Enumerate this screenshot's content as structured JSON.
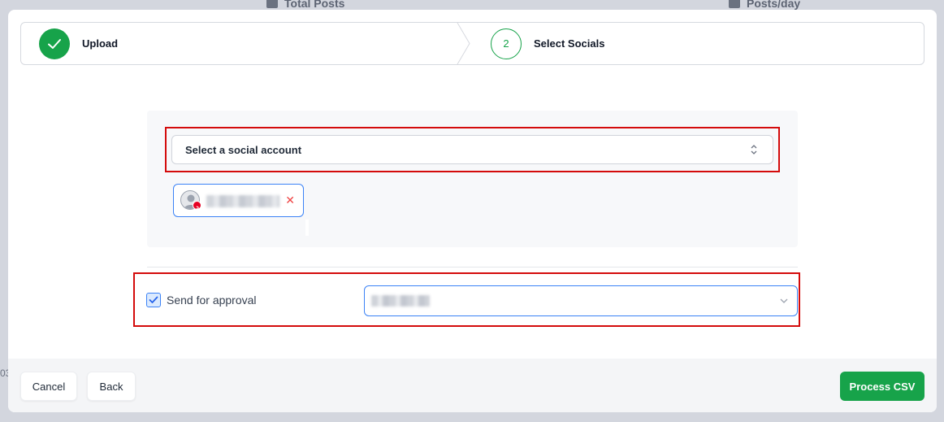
{
  "background": {
    "stat_left": "Total Posts",
    "stat_right": "Posts/day",
    "edge_text": "03"
  },
  "stepper": {
    "steps": [
      {
        "label": "Upload",
        "state": "done"
      },
      {
        "label": "Select Socials",
        "state": "active",
        "number": "2"
      }
    ]
  },
  "social_select": {
    "placeholder": "Select a social account"
  },
  "selected_accounts": [
    {
      "platform": "pinterest",
      "name_redacted": true
    }
  ],
  "approval": {
    "checkbox_checked": true,
    "label": "Send for approval",
    "approver_redacted": true
  },
  "footer": {
    "cancel_label": "Cancel",
    "back_label": "Back",
    "process_label": "Process CSV"
  },
  "colors": {
    "accent_green": "#17a34a",
    "accent_blue": "#3b82f6",
    "highlight_red": "#d40b0b",
    "pinterest_red": "#e60023"
  }
}
